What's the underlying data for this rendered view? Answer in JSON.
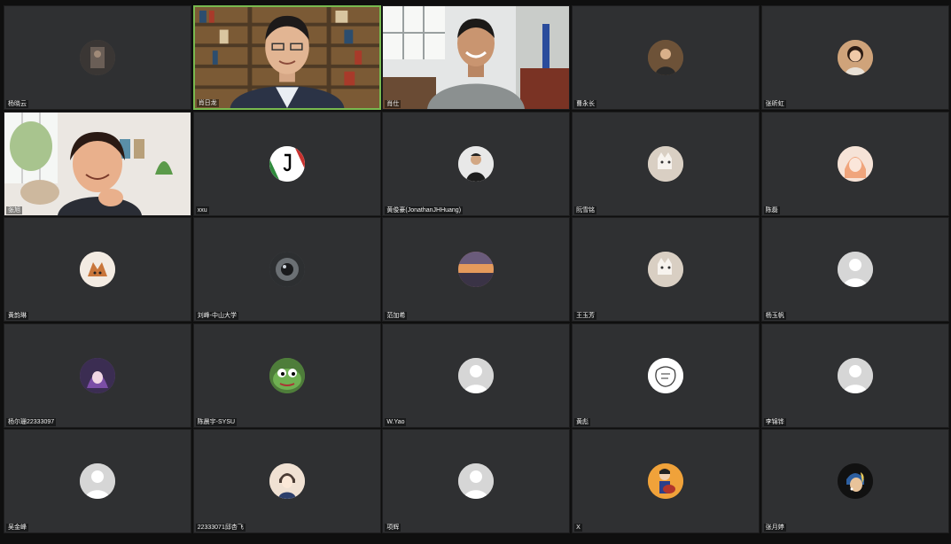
{
  "window": {
    "title": "Video conference gallery view"
  },
  "participants": [
    {
      "name": "杨晓云",
      "type": "avatar",
      "avatar_icon": "dark-photo-avatar-icon",
      "avatar_color": "#5a5550"
    },
    {
      "name": "肖日龙",
      "type": "video",
      "speaking": true,
      "video": "man-bookshelf-video"
    },
    {
      "name": "肖仕",
      "type": "video",
      "video": "man-office-video"
    },
    {
      "name": "曹永长",
      "type": "avatar",
      "avatar_icon": "person-photo-avatar-icon",
      "avatar_color": "#7a5a3c"
    },
    {
      "name": "张昕虹",
      "type": "avatar",
      "avatar_icon": "woman-photo-avatar-icon",
      "avatar_color": "#c99a6a"
    },
    {
      "name": "张旭",
      "type": "video",
      "video": "woman-livingroom-video"
    },
    {
      "name": "xxu",
      "type": "avatar",
      "avatar_icon": "juventus-logo-avatar-icon",
      "avatar_color": "#ffffff"
    },
    {
      "name": "黄俊豪(JonathanJHHuang)",
      "type": "avatar",
      "avatar_icon": "man-photo-avatar-icon",
      "avatar_color": "#e6e6e6"
    },
    {
      "name": "阮雪铭",
      "type": "avatar",
      "avatar_icon": "cat-photo-avatar-icon",
      "avatar_color": "#efe7de"
    },
    {
      "name": "陈磊",
      "type": "avatar",
      "avatar_icon": "anime-girl-avatar-icon",
      "avatar_color": "#f3d6c7"
    },
    {
      "name": "黄韵琳",
      "type": "avatar",
      "avatar_icon": "cartoon-fox-avatar-icon",
      "avatar_color": "#f2e6dc"
    },
    {
      "name": "刘峰-中山大学",
      "type": "avatar",
      "avatar_icon": "camera-lens-avatar-icon",
      "avatar_color": "#555a5e"
    },
    {
      "name": "范加希",
      "type": "avatar",
      "avatar_icon": "sunset-photo-avatar-icon",
      "avatar_color": "#c97a4a"
    },
    {
      "name": "王玉芳",
      "type": "avatar",
      "avatar_icon": "cat-photo-avatar-icon",
      "avatar_color": "#cfc7bb"
    },
    {
      "name": "杨玉帆",
      "type": "avatar",
      "avatar_icon": "default-user-avatar-icon",
      "avatar_color": "#d7d7d7"
    },
    {
      "name": "杨尔珊22333097",
      "type": "avatar",
      "avatar_icon": "anime-character-avatar-icon",
      "avatar_color": "#7b5e8e"
    },
    {
      "name": "陈晨宇-SYSU",
      "type": "avatar",
      "avatar_icon": "pepe-frog-avatar-icon",
      "avatar_color": "#6a9a4a"
    },
    {
      "name": "W.Yao",
      "type": "avatar",
      "avatar_icon": "default-user-avatar-icon",
      "avatar_color": "#d7d7d7"
    },
    {
      "name": "黄彪",
      "type": "avatar",
      "avatar_icon": "sketch-drawing-avatar-icon",
      "avatar_color": "#ffffff"
    },
    {
      "name": "李锦铧",
      "type": "avatar",
      "avatar_icon": "default-user-avatar-icon",
      "avatar_color": "#d7d7d7"
    },
    {
      "name": "吴金峰",
      "type": "avatar",
      "avatar_icon": "default-user-avatar-icon",
      "avatar_color": "#d7d7d7"
    },
    {
      "name": "22333071邱杏飞",
      "type": "avatar",
      "avatar_icon": "anime-boy-avatar-icon",
      "avatar_color": "#f1e3d6"
    },
    {
      "name": "项辉",
      "type": "avatar",
      "avatar_icon": "default-user-avatar-icon",
      "avatar_color": "#d7d7d7"
    },
    {
      "name": "X",
      "type": "avatar",
      "avatar_icon": "guitar-cartoon-avatar-icon",
      "avatar_color": "#e9a13a"
    },
    {
      "name": "张月婷",
      "type": "avatar",
      "avatar_icon": "girl-pearl-earring-avatar-icon",
      "avatar_color": "#1a1a1a"
    }
  ]
}
